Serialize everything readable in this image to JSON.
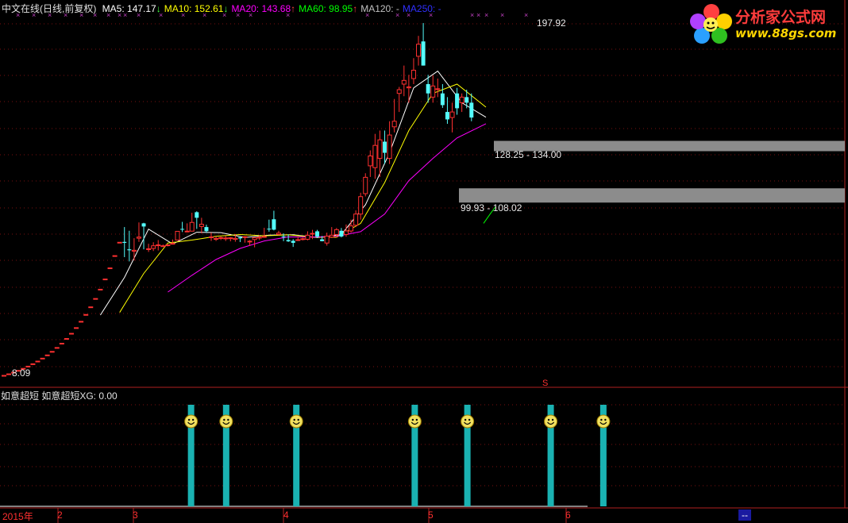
{
  "header": {
    "title": "中文在线(日线,前复权)",
    "ma": [
      {
        "label": "MA5: 147.17",
        "arrow": "↓",
        "color": "#ffffff"
      },
      {
        "label": "MA10: 152.61",
        "arrow": "↓",
        "color": "#ffff00"
      },
      {
        "label": "MA20: 143.68",
        "arrow": "↑",
        "color": "#ff00ff"
      },
      {
        "label": "MA60: 98.95",
        "arrow": "↑",
        "color": "#00ff00"
      },
      {
        "label": "MA120: -",
        "arrow": "",
        "color": "#c0c0c0"
      },
      {
        "label": "MA250: -",
        "arrow": "",
        "color": "#3030ff"
      }
    ]
  },
  "logo": {
    "name": "分析家公式网",
    "url": "www.88gs.com"
  },
  "indicator": {
    "label": "如意超短  如意超短XG: 0.00"
  },
  "xaxis": {
    "year": "2015年",
    "months": [
      "2",
      "3",
      "4",
      "5",
      "6"
    ],
    "end_marker": "--"
  },
  "chart_data": {
    "type": "candlestick",
    "high_label": "197.92",
    "low_label": "8.09",
    "zones": [
      {
        "label": "128.25 - 134.00",
        "low": 128.25,
        "high": 134.0
      },
      {
        "label": "99.93 - 108.02",
        "low": 99.93,
        "high": 108.02
      }
    ],
    "signal_marker": "S",
    "candles": [
      [
        8.09,
        8.09,
        8.09,
        8.09
      ],
      [
        8.9,
        8.9,
        8.9,
        8.9
      ],
      [
        9.79,
        9.79,
        9.79,
        9.79
      ],
      [
        10.77,
        10.77,
        10.77,
        10.77
      ],
      [
        11.85,
        11.85,
        11.85,
        11.85
      ],
      [
        13.04,
        13.04,
        13.04,
        13.04
      ],
      [
        14.34,
        14.34,
        14.34,
        14.34
      ],
      [
        15.77,
        15.77,
        15.77,
        15.77
      ],
      [
        17.35,
        17.35,
        17.35,
        17.35
      ],
      [
        19.09,
        19.09,
        19.09,
        19.09
      ],
      [
        21.0,
        21.0,
        21.0,
        21.0
      ],
      [
        23.1,
        23.1,
        23.1,
        23.1
      ],
      [
        25.4,
        25.4,
        25.4,
        25.4
      ],
      [
        27.95,
        27.95,
        27.95,
        27.95
      ],
      [
        30.74,
        30.74,
        30.74,
        30.74
      ],
      [
        33.8,
        33.8,
        33.8,
        33.8
      ],
      [
        37.2,
        37.2,
        37.2,
        37.2
      ],
      [
        40.9,
        40.9,
        40.9,
        40.9
      ],
      [
        45.0,
        45.0,
        45.0,
        45.0
      ],
      [
        49.5,
        49.5,
        49.5,
        49.5
      ],
      [
        54.5,
        54.5,
        54.5,
        54.5
      ],
      [
        60.0,
        60.0,
        60.0,
        60.0
      ],
      [
        66.0,
        66.0,
        66.0,
        66.0
      ],
      [
        72.6,
        72.6,
        72.6,
        72.6
      ],
      [
        79.8,
        79.8,
        79.8,
        79.8
      ],
      [
        80.0,
        79.5,
        88.0,
        71.8
      ],
      [
        76.0,
        75.5,
        86.0,
        69.5
      ],
      [
        75.0,
        75.5,
        82.0,
        70.0
      ],
      [
        82.0,
        82.6,
        90.5,
        80.0
      ],
      [
        90.0,
        88.3,
        90.3,
        76.0
      ],
      [
        76.3,
        76.3,
        79.0,
        74.6
      ],
      [
        76.5,
        77.9,
        79.8,
        75.1
      ],
      [
        78.0,
        78.4,
        81.0,
        75.4
      ],
      [
        77.7,
        77.9,
        78.6,
        77.6
      ],
      [
        78.0,
        78.4,
        78.6,
        77.6
      ],
      [
        78.9,
        79.2,
        81.3,
        78.6
      ],
      [
        81.0,
        85.7,
        85.8,
        80.9
      ],
      [
        87.0,
        86.9,
        90.8,
        85.3
      ],
      [
        85.8,
        85.8,
        90.0,
        85.2
      ],
      [
        85.8,
        90.5,
        95.7,
        87.3
      ],
      [
        96.0,
        93.0,
        96.5,
        87.0
      ],
      [
        88.3,
        89.5,
        93.0,
        84.6
      ],
      [
        88.0,
        85.8,
        89.3,
        84.9
      ],
      [
        82.5,
        82.7,
        85.0,
        80.5
      ],
      [
        81.5,
        81.8,
        83.0,
        80.5
      ],
      [
        82.0,
        82.3,
        82.9,
        81.0
      ],
      [
        81.8,
        82.1,
        83.2,
        80.5
      ],
      [
        82.0,
        82.2,
        82.6,
        80.3
      ],
      [
        81.4,
        81.9,
        84.2,
        80.1
      ],
      [
        82.5,
        81.9,
        82.6,
        79.9
      ],
      [
        82.6,
        82.8,
        83.1,
        79.6
      ],
      [
        80.0,
        80.4,
        81.0,
        77.8
      ],
      [
        81.3,
        82.3,
        82.6,
        77.1
      ],
      [
        82.4,
        82.5,
        83.6,
        81.0
      ],
      [
        82.7,
        82.9,
        87.6,
        82.4
      ],
      [
        87.1,
        87.0,
        92.0,
        85.5
      ],
      [
        92.2,
        86.6,
        96.8,
        86.2
      ],
      [
        84.0,
        84.7,
        86.0,
        83.7
      ],
      [
        83.0,
        82.8,
        84.6,
        80.4
      ],
      [
        81.0,
        80.3,
        84.0,
        80.0
      ],
      [
        80.6,
        79.5,
        81.5,
        77.3
      ],
      [
        81.1,
        81.2,
        82.7,
        80.5
      ],
      [
        81.4,
        81.7,
        82.3,
        80.8
      ],
      [
        81.4,
        83.6,
        85.7,
        80.8
      ],
      [
        84.3,
        84.6,
        86.5,
        81.5
      ],
      [
        85.7,
        82.8,
        86.5,
        82.1
      ],
      [
        81.4,
        80.4,
        83.2,
        80.3
      ],
      [
        79.4,
        83.1,
        85.0,
        78.0
      ],
      [
        82.6,
        83.6,
        88.0,
        82.1
      ],
      [
        84.0,
        86.6,
        87.5,
        82.4
      ],
      [
        86.0,
        82.9,
        87.5,
        82.4
      ],
      [
        84.0,
        85.9,
        89.4,
        82.8
      ],
      [
        85.9,
        88.6,
        92.0,
        85.0
      ],
      [
        89.0,
        95.0,
        97.0,
        88.0
      ],
      [
        95.0,
        104.4,
        106.5,
        92.0
      ],
      [
        106.0,
        114.8,
        117.0,
        104.5
      ],
      [
        121.0,
        126.3,
        129.3,
        115.0
      ],
      [
        120.0,
        132.0,
        138.2,
        114.0
      ],
      [
        125.0,
        135.0,
        140.0,
        115.0
      ],
      [
        134.0,
        128.0,
        140.0,
        122.0
      ],
      [
        125.0,
        137.6,
        145.0,
        122.0
      ],
      [
        142.0,
        145.0,
        157.0,
        139.0
      ],
      [
        160.0,
        162.0,
        163.5,
        150.0
      ],
      [
        165.0,
        167.0,
        175.0,
        158.5
      ],
      [
        163.0,
        163.5,
        170.0,
        155.0
      ],
      [
        168.0,
        172.5,
        179.0,
        165.0
      ],
      [
        180.0,
        186.5,
        191.0,
        175.0
      ],
      [
        188.0,
        175.0,
        197.9,
        175.0
      ],
      [
        165.0,
        160.0,
        170.0,
        155.0
      ],
      [
        158.0,
        164.0,
        169.6,
        155.0
      ],
      [
        162.5,
        162.5,
        168.0,
        158.0
      ],
      [
        160.0,
        153.7,
        165.0,
        152.2
      ],
      [
        150.0,
        146.0,
        158.0,
        143.6
      ],
      [
        147.0,
        150.0,
        155.0,
        139.0
      ],
      [
        160.0,
        152.0,
        163.0,
        148.5
      ],
      [
        155.0,
        158.0,
        160.0,
        150.0
      ],
      [
        158.0,
        155.0,
        162.0,
        152.0
      ],
      [
        155.0,
        147.0,
        160.0,
        145.0
      ]
    ],
    "ma_lines": {
      "MA5": [
        [
          20,
          40.6
        ],
        [
          25,
          60.9
        ],
        [
          30,
          86.9
        ],
        [
          35,
          78.9
        ],
        [
          40,
          85.2
        ],
        [
          45,
          85.0
        ],
        [
          50,
          82.4
        ],
        [
          55,
          83.7
        ],
        [
          60,
          83.9
        ],
        [
          65,
          82.3
        ],
        [
          70,
          84.0
        ],
        [
          75,
          100.0
        ],
        [
          80,
          128.0
        ],
        [
          85,
          163.0
        ],
        [
          90,
          172.0
        ],
        [
          95,
          155.0
        ],
        [
          100,
          147.17
        ]
      ],
      "MA10": [
        [
          24,
          42.0
        ],
        [
          29,
          63.0
        ],
        [
          34,
          79.4
        ],
        [
          39,
          81.0
        ],
        [
          44,
          83.0
        ],
        [
          49,
          84.0
        ],
        [
          54,
          83.3
        ],
        [
          59,
          83.8
        ],
        [
          64,
          82.6
        ],
        [
          69,
          82.5
        ],
        [
          74,
          90.0
        ],
        [
          79,
          112.0
        ],
        [
          84,
          140.0
        ],
        [
          89,
          160.0
        ],
        [
          94,
          165.0
        ],
        [
          100,
          152.61
        ]
      ],
      "MA20": [
        [
          34,
          53.0
        ],
        [
          39,
          62.0
        ],
        [
          44,
          70.5
        ],
        [
          49,
          76.5
        ],
        [
          54,
          80.5
        ],
        [
          59,
          82.7
        ],
        [
          64,
          82.6
        ],
        [
          69,
          83.0
        ],
        [
          74,
          85.5
        ],
        [
          79,
          95.0
        ],
        [
          84,
          113.0
        ],
        [
          89,
          125.0
        ],
        [
          94,
          136.0
        ],
        [
          100,
          143.68
        ]
      ],
      "MA60": [
        [
          99.5,
          90.0
        ],
        [
          101,
          95.5
        ],
        [
          102,
          98.95
        ]
      ]
    },
    "signals": [
      42,
      50,
      66,
      93,
      105,
      124,
      136
    ]
  }
}
